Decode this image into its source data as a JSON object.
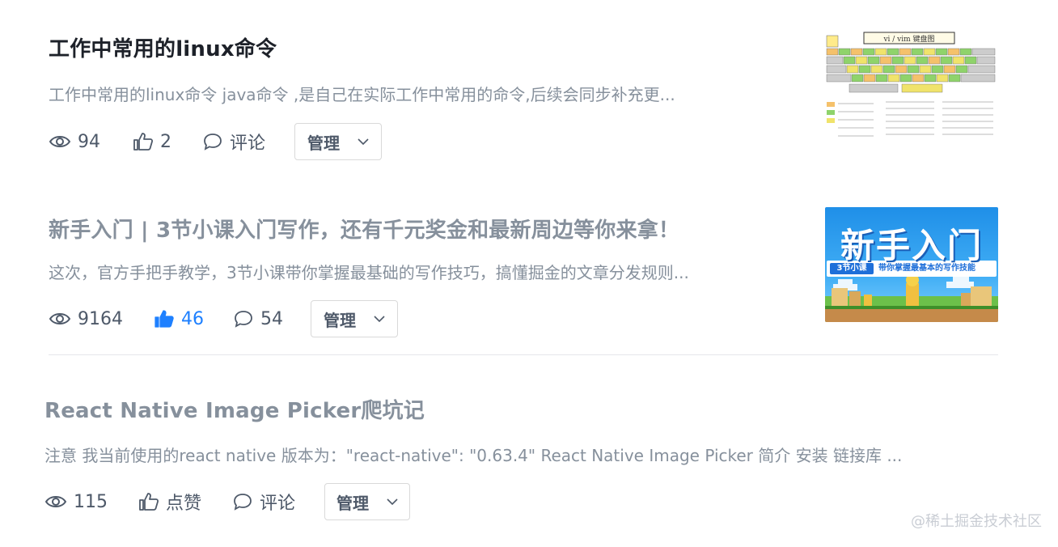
{
  "articles": [
    {
      "title": "工作中常用的linux命令",
      "abstract": "工作中常用的linux命令 java命令 ,是自己在实际工作中常用的命令,后续会同步补充更...",
      "views": "94",
      "likes": "2",
      "comments": "评论",
      "manage_label": "管理",
      "thumbnail": {
        "caption": "vi / vim 键盘图"
      }
    },
    {
      "title": "新手入门 | 3节小课入门写作，还有千元奖金和最新周边等你来拿！",
      "abstract": "这次，官方手把手教学，3节小课带你掌握最基础的写作技巧，搞懂掘金的文章分发规则...",
      "views": "9164",
      "likes": "46",
      "comments": "54",
      "manage_label": "管理",
      "thumbnail": {
        "headline": "新手入门",
        "badge": "3节小课",
        "subtitle": "带你掌握最基本的写作技能"
      }
    },
    {
      "title": "React Native Image Picker爬坑记",
      "abstract": "注意 我当前使用的react native 版本为：\"react-native\": \"0.63.4\" React Native Image Picker 简介 安装 链接库 ...",
      "views": "115",
      "likes": "点赞",
      "comments": "评论",
      "manage_label": "管理"
    }
  ],
  "watermark": "@稀土掘金技术社区",
  "colors": {
    "title": "#1d2129",
    "muted_title": "#86909c",
    "text": "#4e5969",
    "accent": "#1e80ff",
    "border": "#d9d9d9"
  },
  "icons": {
    "views": "eye-icon",
    "likes": "thumb-up-icon",
    "liked": "thumb-up-filled-icon",
    "comments": "comment-icon",
    "manage": "chevron-down-icon"
  }
}
